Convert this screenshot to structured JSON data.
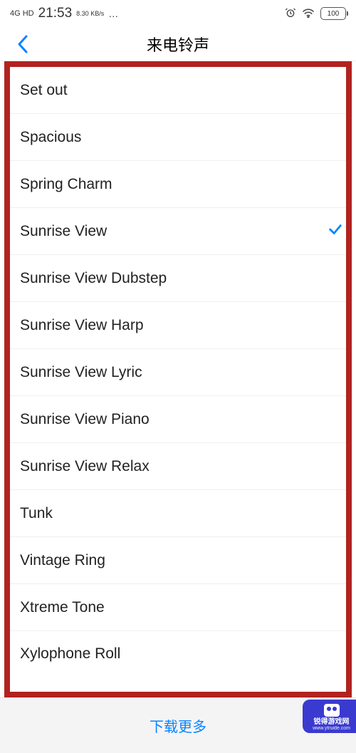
{
  "status": {
    "network_type": "4G HD",
    "time": "21:53",
    "data_rate": "8.30\nKB/s",
    "battery_pct": "100"
  },
  "header": {
    "title": "来电铃声"
  },
  "ringtones": [
    {
      "name": "Set out",
      "selected": false
    },
    {
      "name": "Spacious",
      "selected": false
    },
    {
      "name": "Spring Charm",
      "selected": false
    },
    {
      "name": "Sunrise View",
      "selected": true
    },
    {
      "name": "Sunrise View Dubstep",
      "selected": false
    },
    {
      "name": "Sunrise View Harp",
      "selected": false
    },
    {
      "name": "Sunrise View Lyric",
      "selected": false
    },
    {
      "name": "Sunrise View Piano",
      "selected": false
    },
    {
      "name": "Sunrise View Relax",
      "selected": false
    },
    {
      "name": "Tunk",
      "selected": false
    },
    {
      "name": "Vintage Ring",
      "selected": false
    },
    {
      "name": "Xtreme Tone",
      "selected": false
    },
    {
      "name": "Xylophone Roll",
      "selected": false
    }
  ],
  "footer": {
    "download_more": "下载更多"
  },
  "watermark": {
    "brand": "锐得游戏网",
    "url": "www.ytruide.com"
  },
  "annotation": {
    "highlight_box_color": "#b1221f",
    "arrow_color": "#d8171a"
  }
}
